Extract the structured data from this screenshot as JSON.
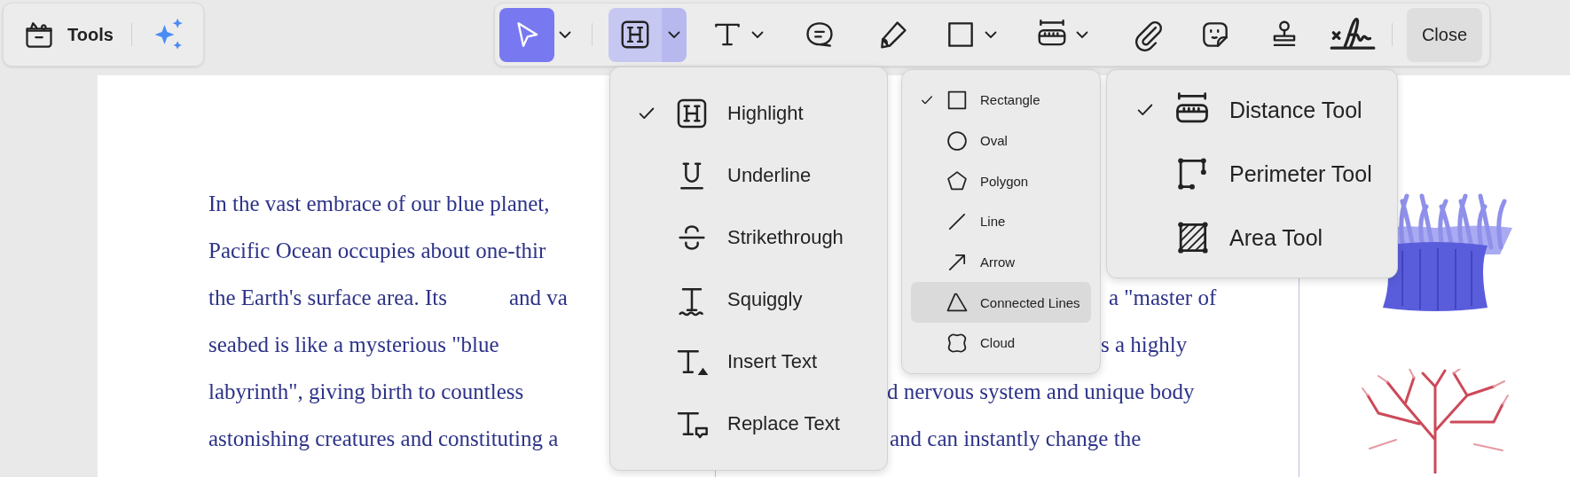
{
  "tools_panel": {
    "label": "Tools"
  },
  "toolbar": {
    "items": [
      {
        "kind": "select",
        "selected": true,
        "expanded": false,
        "dropdown": true
      },
      {
        "kind": "highlight",
        "selected": false,
        "expanded": true,
        "dropdown": true
      },
      {
        "kind": "text",
        "selected": false,
        "expanded": false,
        "dropdown": true
      },
      {
        "kind": "comment",
        "selected": false,
        "expanded": false,
        "dropdown": false
      },
      {
        "kind": "pencil",
        "selected": false,
        "expanded": false,
        "dropdown": false
      },
      {
        "kind": "shape",
        "selected": false,
        "expanded": false,
        "dropdown": true
      },
      {
        "kind": "measure",
        "selected": false,
        "expanded": false,
        "dropdown": true
      },
      {
        "kind": "attachment",
        "selected": false,
        "expanded": false,
        "dropdown": false
      },
      {
        "kind": "sticker",
        "selected": false,
        "expanded": false,
        "dropdown": false
      },
      {
        "kind": "stamp",
        "selected": false,
        "expanded": false,
        "dropdown": false
      },
      {
        "kind": "signature",
        "selected": false,
        "expanded": false,
        "dropdown": false
      }
    ],
    "close_button": "Close"
  },
  "document": {
    "left_lines": [
      {
        "segments": [
          "In the vast embrace of our blue planet,"
        ]
      },
      {
        "segments": [
          "Pacific Ocean occupies about one-thir"
        ]
      },
      {
        "segments": [
          "the Earth's surface area. Its",
          "and va"
        ]
      },
      {
        "segments": [
          "seabed is like a mysterious \"blue"
        ]
      },
      {
        "segments": [
          "labyrinth\", giving birth to countless"
        ]
      },
      {
        "segments": [
          "astonishing creatures and constituting a"
        ]
      }
    ],
    "right_fragments": [
      "a \"master of",
      "s a highly",
      "d nervous system and unique body",
      "and can instantly change the"
    ]
  },
  "highlight_menu": {
    "items": [
      {
        "kind": "highlight",
        "label": "Highlight",
        "checked": true
      },
      {
        "kind": "underline",
        "label": "Underline",
        "checked": false
      },
      {
        "kind": "strikethrough",
        "label": "Strikethrough",
        "checked": false
      },
      {
        "kind": "squiggly",
        "label": "Squiggly",
        "checked": false
      },
      {
        "kind": "insert",
        "label": "Insert Text",
        "checked": false
      },
      {
        "kind": "replace",
        "label": "Replace Text",
        "checked": false
      }
    ]
  },
  "shape_menu": {
    "items": [
      {
        "kind": "rectangle",
        "label": "Rectangle",
        "checked": true,
        "hovered": false
      },
      {
        "kind": "oval",
        "label": "Oval",
        "checked": false,
        "hovered": false
      },
      {
        "kind": "polygon",
        "label": "Polygon",
        "checked": false,
        "hovered": false
      },
      {
        "kind": "line",
        "label": "Line",
        "checked": false,
        "hovered": false
      },
      {
        "kind": "arrow",
        "label": "Arrow",
        "checked": false,
        "hovered": false
      },
      {
        "kind": "connected",
        "label": "Connected Lines",
        "checked": false,
        "hovered": true
      },
      {
        "kind": "cloud",
        "label": "Cloud",
        "checked": false,
        "hovered": false
      }
    ]
  },
  "measure_menu": {
    "items": [
      {
        "kind": "distance",
        "label": "Distance Tool",
        "checked": true
      },
      {
        "kind": "perimeter",
        "label": "Perimeter Tool",
        "checked": false
      },
      {
        "kind": "area",
        "label": "Area Tool",
        "checked": false
      }
    ]
  }
}
